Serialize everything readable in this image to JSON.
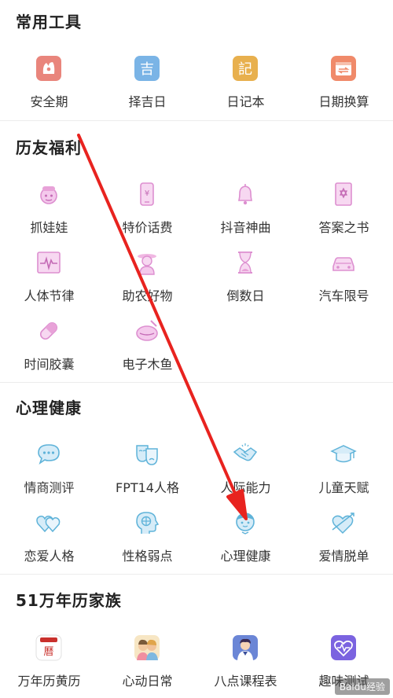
{
  "sections": [
    {
      "title": "常用工具",
      "items": [
        {
          "label": "安全期",
          "icon": "safe-period-icon"
        },
        {
          "label": "择吉日",
          "icon": "lucky-day-icon",
          "icon_text": "吉"
        },
        {
          "label": "日记本",
          "icon": "diary-icon",
          "icon_text": "記"
        },
        {
          "label": "日期换算",
          "icon": "date-convert-icon"
        }
      ]
    },
    {
      "title": "历友福利",
      "items": [
        {
          "label": "抓娃娃",
          "icon": "claw-machine-icon"
        },
        {
          "label": "特价话费",
          "icon": "phone-bill-icon"
        },
        {
          "label": "抖音神曲",
          "icon": "bell-icon"
        },
        {
          "label": "答案之书",
          "icon": "answer-book-icon"
        },
        {
          "label": "人体节律",
          "icon": "biorhythm-icon"
        },
        {
          "label": "助农好物",
          "icon": "farmer-icon"
        },
        {
          "label": "倒数日",
          "icon": "hourglass-icon"
        },
        {
          "label": "汽车限号",
          "icon": "car-icon"
        },
        {
          "label": "时间胶囊",
          "icon": "capsule-icon"
        },
        {
          "label": "电子木鱼",
          "icon": "wooden-fish-icon"
        }
      ]
    },
    {
      "title": "心理健康",
      "items": [
        {
          "label": "情商测评",
          "icon": "chat-bubble-icon"
        },
        {
          "label": "FPT14人格",
          "icon": "masks-icon"
        },
        {
          "label": "人际能力",
          "icon": "handshake-icon"
        },
        {
          "label": "儿童天赋",
          "icon": "graduation-cap-icon"
        },
        {
          "label": "恋爱人格",
          "icon": "double-heart-icon"
        },
        {
          "label": "性格弱点",
          "icon": "brain-head-icon"
        },
        {
          "label": "心理健康",
          "icon": "child-face-icon"
        },
        {
          "label": "爱情脱单",
          "icon": "heart-arrow-icon"
        }
      ]
    },
    {
      "title": "51万年历家族",
      "items": [
        {
          "label": "万年历黄历",
          "icon": "almanac-app-icon",
          "icon_text": "曆"
        },
        {
          "label": "心动日常",
          "icon": "couple-app-icon"
        },
        {
          "label": "八点课程表",
          "icon": "schedule-app-icon"
        },
        {
          "label": "趣味测试",
          "icon": "heart-test-app-icon"
        }
      ]
    }
  ],
  "watermark": "Baidu经验",
  "colors": {
    "tools_accent": "#e8a04a",
    "welfare_accent": "#e8a2d8",
    "psych_accent": "#5fb3d9",
    "annotation_arrow": "#e8231f"
  }
}
